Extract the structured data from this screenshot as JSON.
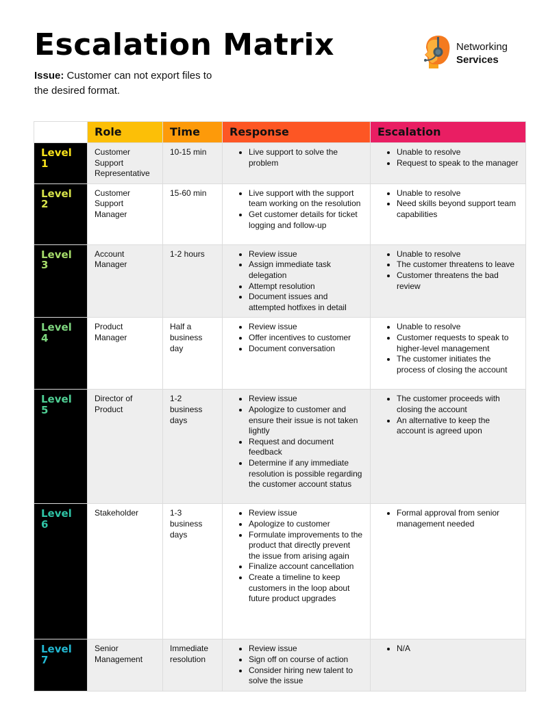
{
  "header": {
    "title": "Escalation Matrix",
    "issue_label": "Issue:",
    "issue_text": " Customer can not export files to the desired format."
  },
  "logo": {
    "icon": "support-agent-headset-icon",
    "line1": "Networking",
    "line2": "Services"
  },
  "colors": {
    "role_header": "#fcbf07",
    "time_header": "#fd9a0a",
    "response_header": "#fd5624",
    "escalation_header": "#e91e63",
    "level_cell_bg": "#000000",
    "odd_row_bg": "#eeeeee",
    "level_text": [
      "#f7e11b",
      "#d7e34a",
      "#a6dc6a",
      "#7ed67f",
      "#4fcf94",
      "#2fc4a6",
      "#22b8d2"
    ]
  },
  "table": {
    "columns": [
      "",
      "Role",
      "Time",
      "Response",
      "Escalation"
    ],
    "rows": [
      {
        "level": "Level 1",
        "role": "Customer Support Representative",
        "time": "10-15 min",
        "response": [
          "Live support to solve the problem"
        ],
        "escalation": [
          "Unable to resolve",
          "Request to speak to the manager"
        ]
      },
      {
        "level": "Level 2",
        "role": "Customer Support Manager",
        "time": "15-60 min",
        "response": [
          "Live support with the support team working on the resolution",
          "Get customer details for ticket logging and follow-up"
        ],
        "escalation": [
          "Unable to resolve",
          "Need skills beyond support team capabilities"
        ]
      },
      {
        "level": "Level 3",
        "role": "Account Manager",
        "time": "1-2 hours",
        "response": [
          "Review issue",
          "Assign immediate task delegation",
          "Attempt resolution",
          "Document issues and attempted hotfixes in detail"
        ],
        "escalation": [
          "Unable to resolve",
          "The customer threatens to leave",
          "Customer threatens the bad review"
        ]
      },
      {
        "level": "Level 4",
        "role": "Product Manager",
        "time": "Half a business day",
        "response": [
          "Review issue",
          "Offer incentives to customer",
          "Document conversation"
        ],
        "escalation": [
          "Unable to resolve",
          "Customer requests to speak to higher-level management",
          "The customer initiates the process of closing the account"
        ]
      },
      {
        "level": "Level 5",
        "role": "Director of Product",
        "time": "1-2 business days",
        "response": [
          "Review issue",
          "Apologize to customer and ensure their issue is not taken lightly",
          "Request and document feedback",
          "Determine if any immediate resolution is possible regarding the customer account status"
        ],
        "escalation": [
          "The customer proceeds with closing the account",
          "An alternative to keep the account is agreed upon"
        ]
      },
      {
        "level": "Level 6",
        "role": "Stakeholder",
        "time": "1-3 business days",
        "response": [
          "Review issue",
          "Apologize to customer",
          "Formulate improvements to the product that directly prevent the issue from arising again",
          "Finalize account cancellation",
          "Create a timeline to keep customers in the loop about future product upgrades"
        ],
        "escalation": [
          "Formal approval from senior management needed"
        ]
      },
      {
        "level": "Level 7",
        "role": "Senior Management",
        "time": "Immediate resolution",
        "response": [
          "Review issue",
          "Sign off on course of action",
          "Consider hiring new talent to solve the issue"
        ],
        "escalation": [
          "N/A"
        ]
      }
    ]
  }
}
